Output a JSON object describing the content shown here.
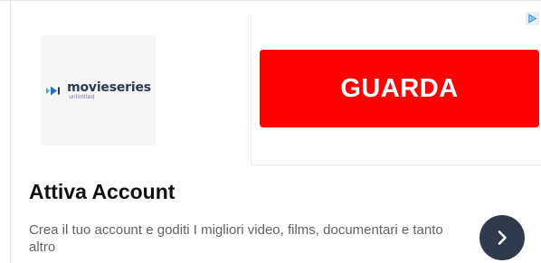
{
  "ad": {
    "brand": {
      "name": "movieseries",
      "tagline": "unlimited",
      "logo_icon": "movieseries-logo-icon",
      "logo_color": "#2b3a55"
    },
    "cta": {
      "label": "GUARDA",
      "background_color": "#ff0000",
      "text_color": "#ffffff"
    },
    "adchoices_icon": "adchoices-icon",
    "headline": "Attiva Account",
    "description": "Crea il tuo account e goditi I migliori video, films, documentari e tanto altro",
    "next_button": {
      "icon": "chevron-right-icon",
      "background_color": "#2f3b4c"
    }
  }
}
